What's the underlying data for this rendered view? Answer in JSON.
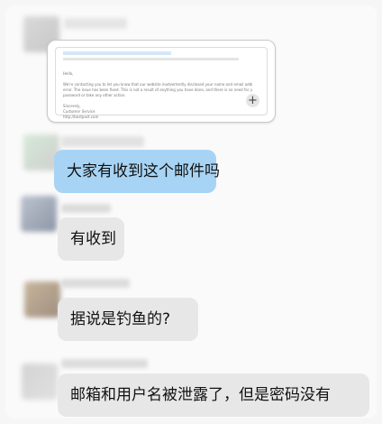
{
  "email_preview": {
    "lines": [
      "We're contacting you to let you know that our website inadvertently disclosed your name and email address due to a technical",
      "error. The issue has been fixed. This is not a result of anything you have done, and there is no need for you to change your",
      "password or take any other action.",
      "Sincerely,",
      "Customer Service",
      "http://bestpost.com"
    ],
    "greeting": "Hello,"
  },
  "messages": [
    {
      "text": "大家有收到这个邮件吗",
      "style": "blue"
    },
    {
      "text": "有收到",
      "style": "gray"
    },
    {
      "text": "据说是钓鱼的?",
      "style": "gray"
    },
    {
      "text": "邮箱和用户名被泄露了，但是密码没有",
      "style": "gray"
    }
  ],
  "plus_symbol": "+"
}
